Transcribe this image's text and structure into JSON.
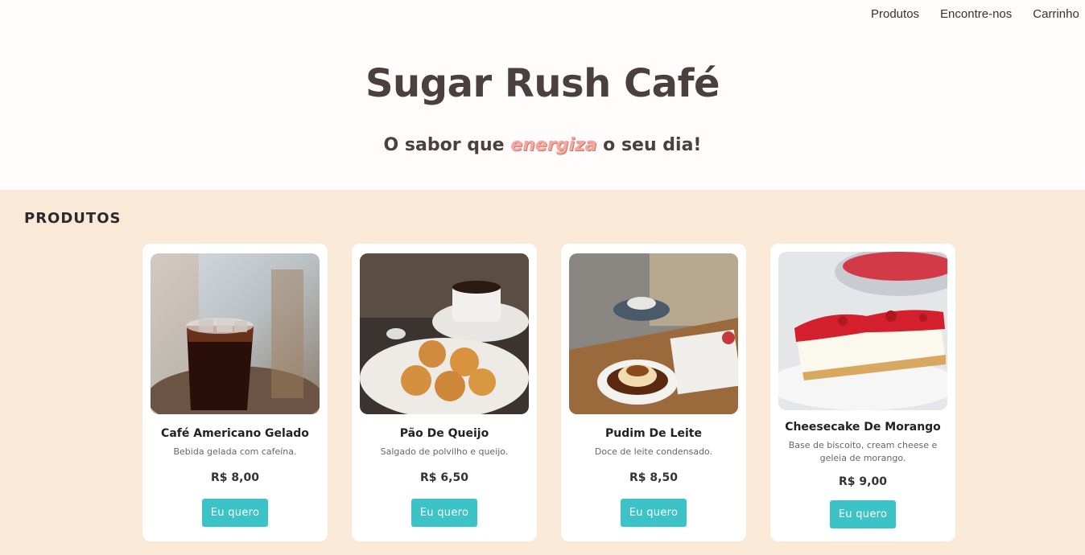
{
  "nav": {
    "items": [
      "Produtos",
      "Encontre-nos",
      "Carrinho"
    ]
  },
  "hero": {
    "title": "Sugar Rush Café",
    "tagline_before": "O sabor que ",
    "tagline_highlight": "energiza",
    "tagline_after": " o seu dia!"
  },
  "products": {
    "section_title": "PRODUTOS",
    "items": [
      {
        "name": "Café Americano Gelado",
        "description": "Bebida gelada com cafeína.",
        "price": "R$ 8,00",
        "button": "Eu quero"
      },
      {
        "name": "Pão De Queijo",
        "description": "Salgado de polvilho e queijo.",
        "price": "R$ 6,50",
        "button": "Eu quero"
      },
      {
        "name": "Pudim De Leite",
        "description": "Doce de leite condensado.",
        "price": "R$ 8,50",
        "button": "Eu quero"
      },
      {
        "name": "Cheesecake De Morango",
        "description": "Base de biscoito, cream cheese e geleia de morango.",
        "price": "R$ 9,00",
        "button": "Eu quero"
      }
    ]
  }
}
